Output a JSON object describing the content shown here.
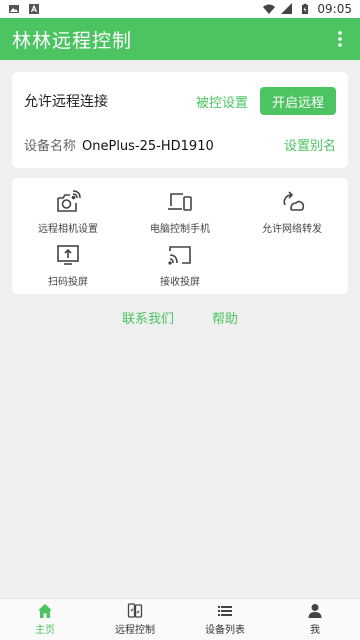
{
  "status_bar": {
    "time": "09:05"
  },
  "app_bar": {
    "title": "林林远程控制"
  },
  "remote_card": {
    "allow_label": "允许远程连接",
    "controlled_settings": "被控设置",
    "start_button": "开启远程",
    "device_name_label": "设备名称",
    "device_name_value": "OnePlus-25-HD1910",
    "set_alias": "设置别名"
  },
  "features": [
    {
      "label": "远程相机设置",
      "icon": "camera-settings-icon"
    },
    {
      "label": "电脑控制手机",
      "icon": "pc-phone-icon"
    },
    {
      "label": "允许网络转发",
      "icon": "network-forward-icon"
    },
    {
      "label": "扫码投屏",
      "icon": "scan-cast-icon"
    },
    {
      "label": "接收投屏",
      "icon": "cast-receive-icon"
    }
  ],
  "links": {
    "contact": "联系我们",
    "help": "帮助"
  },
  "bottom_nav": [
    {
      "label": "主页",
      "icon": "home-icon",
      "active": true
    },
    {
      "label": "远程控制",
      "icon": "remote-control-icon",
      "active": false
    },
    {
      "label": "设备列表",
      "icon": "list-icon",
      "active": false
    },
    {
      "label": "我",
      "icon": "person-icon",
      "active": false
    }
  ],
  "colors": {
    "accent": "#4cc462",
    "background": "#efefef"
  }
}
